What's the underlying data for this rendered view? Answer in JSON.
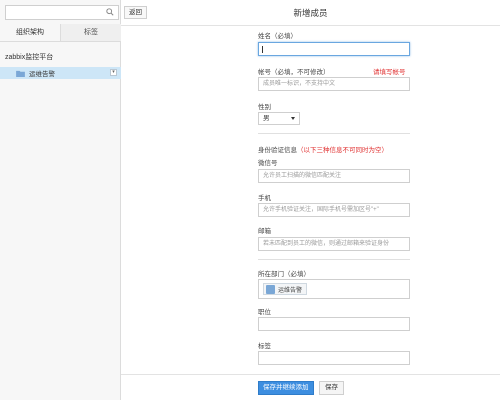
{
  "sidebar": {
    "search": {
      "value": "",
      "placeholder": ""
    },
    "tabs": [
      {
        "label": "组织架构",
        "active": true
      },
      {
        "label": "标签",
        "active": false
      }
    ],
    "tree": {
      "root_label": "zabbix监控平台",
      "nodes": [
        {
          "label": "运维告警",
          "selected": true
        }
      ]
    }
  },
  "header": {
    "back_label": "返回",
    "title": "新增成员"
  },
  "form": {
    "name": {
      "label": "姓名（必填）",
      "value": ""
    },
    "account": {
      "label": "帐号（必填，不可修改）",
      "link": "请填写帐号",
      "placeholder": "成员唯一标识，不支持中文"
    },
    "gender": {
      "label": "性别",
      "selected": "男"
    },
    "identity_section": {
      "label": "身份验证信息",
      "note": "（以下三种信息不可同时为空）"
    },
    "wechat": {
      "label": "微信号",
      "placeholder": "允许员工扫描的微信匹配关注"
    },
    "phone": {
      "label": "手机",
      "placeholder": "允许手机验证关注，国际手机号需加区号\"+\""
    },
    "email": {
      "label": "邮箱",
      "placeholder": "若未匹配到员工的微信，则通过邮箱来验证身份"
    },
    "department": {
      "label": "所在部门（必填）",
      "chip": "运维告警"
    },
    "position": {
      "label": "职位",
      "value": ""
    },
    "tag": {
      "label": "标签",
      "value": ""
    }
  },
  "footer": {
    "save_continue_label": "保存并继续添加",
    "save_label": "保存"
  },
  "colors": {
    "primary": "#3d8ee0",
    "selected_bg": "#cde6f7",
    "required_red": "#e02f2f"
  }
}
